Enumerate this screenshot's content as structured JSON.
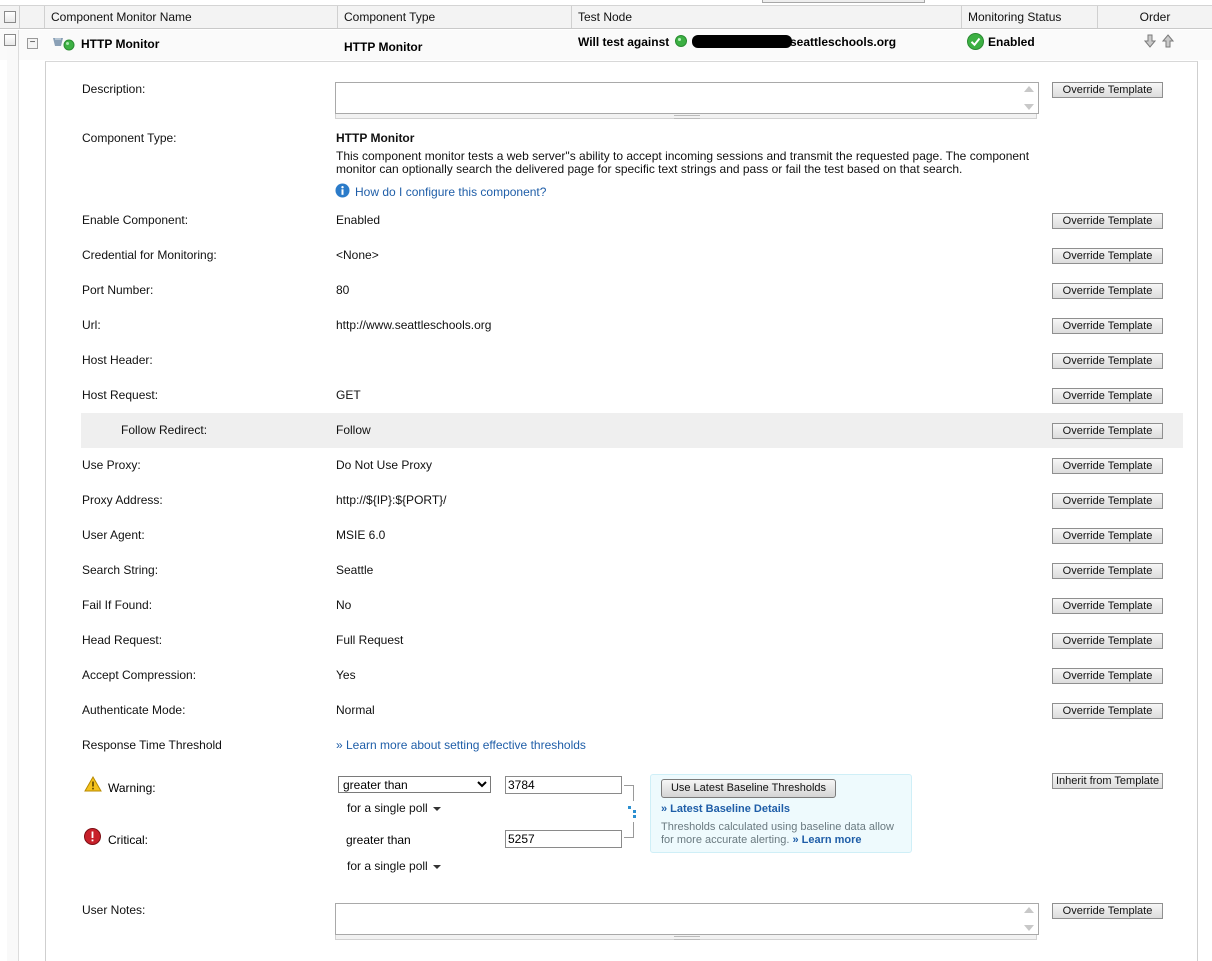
{
  "columns": [
    "Component Monitor Name",
    "Component Type",
    "Test Node",
    "Monitoring Status",
    "Order"
  ],
  "row": {
    "name": "HTTP Monitor",
    "type": "HTTP Monitor",
    "test_node_prefix": "Will test against",
    "test_node_host": "seattleschools.org",
    "status": "Enabled"
  },
  "fields": {
    "description_label": "Description:",
    "component_type_label": "Component Type:",
    "component_type_value": "HTTP Monitor",
    "component_desc": "This component monitor tests a web server\"s ability to accept incoming sessions and transmit the requested page. The component monitor can optionally search the delivered page for specific text strings and pass or fail the test based on that search.",
    "config_link": "How do I configure this component?",
    "rows": [
      {
        "label": "Enable Component:",
        "value": "Enabled"
      },
      {
        "label": "Credential for Monitoring:",
        "value": "<None>"
      },
      {
        "label": "Port Number:",
        "value": "80"
      },
      {
        "label": "Url:",
        "value": "http://www.seattleschools.org"
      },
      {
        "label": "Host Header:",
        "value": ""
      },
      {
        "label": "Host Request:",
        "value": "GET"
      },
      {
        "label": "Follow Redirect:",
        "value": "Follow"
      },
      {
        "label": "Use Proxy:",
        "value": "Do Not Use Proxy"
      },
      {
        "label": "Proxy Address:",
        "value": "http://${IP}:${PORT}/"
      },
      {
        "label": "User Agent:",
        "value": "MSIE 6.0"
      },
      {
        "label": "Search String:",
        "value": "Seattle"
      },
      {
        "label": "Fail If Found:",
        "value": "No"
      },
      {
        "label": "Head Request:",
        "value": "Full Request"
      },
      {
        "label": "Accept Compression:",
        "value": "Yes"
      },
      {
        "label": "Authenticate Mode:",
        "value": "Normal"
      }
    ],
    "user_notes_label": "User Notes:"
  },
  "buttons": {
    "override": "Override Template",
    "inherit": "Inherit from Template",
    "use_baseline": "Use Latest Baseline Thresholds"
  },
  "threshold": {
    "label": "Response Time Threshold",
    "learn_link": "» Learn more about setting effective thresholds",
    "warning_label": "Warning:",
    "critical_label": "Critical:",
    "warning_operator": "greater than",
    "critical_operator": "greater than",
    "warning_value": "3784",
    "critical_value": "5257",
    "poll_text": "for  a single poll",
    "baseline_link": "» Latest Baseline Details",
    "baseline_note": "Thresholds calculated using baseline data allow for more accurate alerting.",
    "baseline_learn": "» Learn more"
  },
  "colors": {
    "link": "#1f5ea8",
    "status_green": "#3cb043",
    "highlight_row": "#efefef"
  }
}
